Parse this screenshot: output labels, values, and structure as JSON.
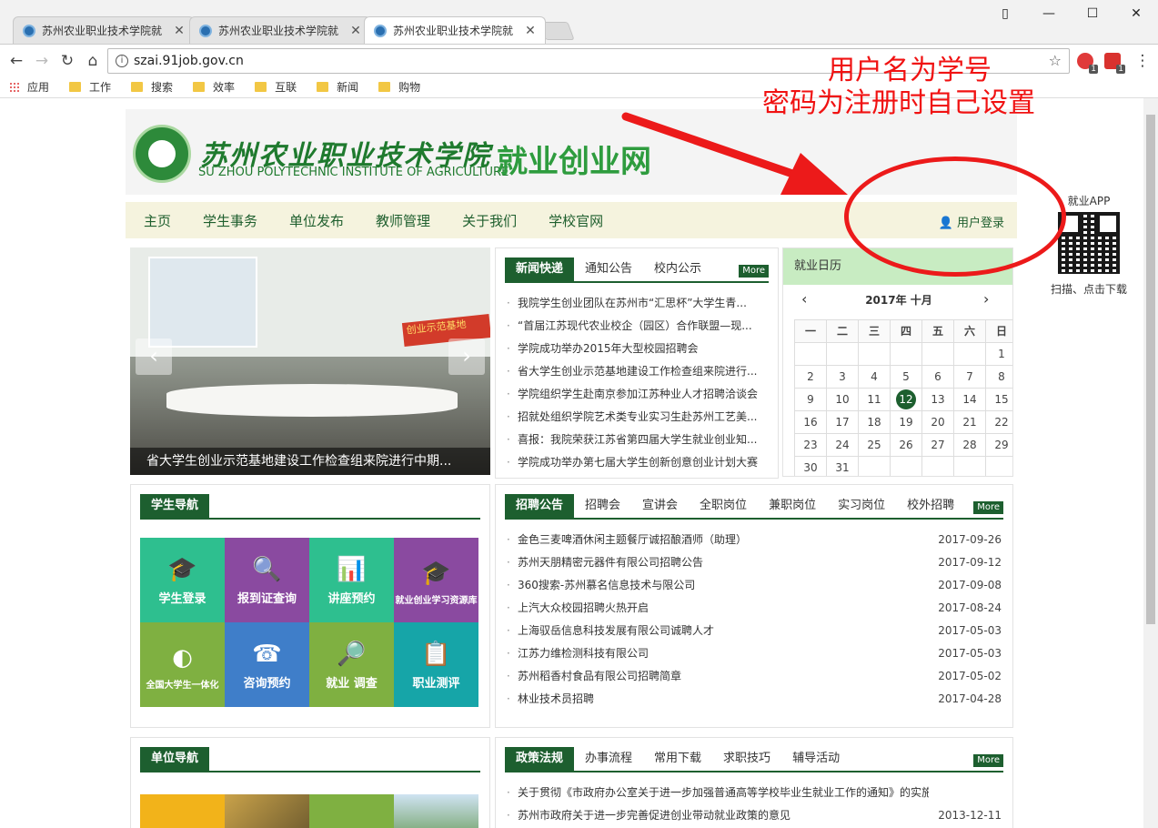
{
  "browser": {
    "tabs": [
      {
        "title": "苏州农业职业技术学院就"
      },
      {
        "title": "苏州农业职业技术学院就"
      },
      {
        "title": "苏州农业职业技术学院就"
      }
    ],
    "url": "szai.91job.gov.cn",
    "bookmarks": [
      "应用",
      "工作",
      "搜索",
      "效率",
      "互联",
      "新闻",
      "购物"
    ],
    "ext_badges": [
      "1",
      "1"
    ]
  },
  "annotation": {
    "line1": "用户名为学号",
    "line2": "密码为注册时自己设置"
  },
  "header": {
    "school_cn": "苏州农业职业技术学院",
    "school_en": "SU ZHOU POLYTECHNIC INSTITUTE OF AGRICULTURE",
    "site_name": "就业创业网"
  },
  "nav": {
    "items": [
      "主页",
      "学生事务",
      "单位发布",
      "教师管理",
      "关于我们",
      "学校官网"
    ],
    "login": "用户登录"
  },
  "slider": {
    "caption": "省大学生创业示范基地建设工作检查组来院进行中期...",
    "banner": "创业示范基地"
  },
  "news": {
    "tabs": [
      "新闻快递",
      "通知公告",
      "校内公示"
    ],
    "more": "More",
    "items": [
      "我院学生创业团队在苏州市“汇思杯”大学生青...",
      "“首届江苏现代农业校企（园区）合作联盟—现...",
      "学院成功举办2015年大型校园招聘会",
      "省大学生创业示范基地建设工作检查组来院进行...",
      "学院组织学生赴南京参加江苏种业人才招聘洽谈会",
      "招就处组织学院艺术类专业实习生赴苏州工艺美...",
      "喜报：我院荣获江苏省第四届大学生就业创业知...",
      "学院成功举办第七届大学生创新创意创业计划大赛"
    ]
  },
  "calendar": {
    "title": "就业日历",
    "month": "2017年 十月",
    "weekdays": [
      "一",
      "二",
      "三",
      "四",
      "五",
      "六",
      "日"
    ],
    "cells": [
      "",
      "",
      "",
      "",
      "",
      "",
      "1",
      "2",
      "3",
      "4",
      "5",
      "6",
      "7",
      "8",
      "9",
      "10",
      "11",
      "12",
      "13",
      "14",
      "15",
      "16",
      "17",
      "18",
      "19",
      "20",
      "21",
      "22",
      "23",
      "24",
      "25",
      "26",
      "27",
      "28",
      "29",
      "30",
      "31",
      "",
      "",
      "",
      "",
      ""
    ],
    "today": "12"
  },
  "app": {
    "label": "就业APP",
    "hint": "扫描、点击下载"
  },
  "student_guide": {
    "title": "学生导航",
    "tiles": [
      {
        "label": "学生登录",
        "color": "#2ebf8f"
      },
      {
        "label": "报到证查询",
        "color": "#8a4aa0"
      },
      {
        "label": "讲座预约",
        "color": "#2ebf8f"
      },
      {
        "label": "就业创业学习资源库",
        "color": "#8a4aa0"
      },
      {
        "label": "全国大学生一体化",
        "color": "#7fb041"
      },
      {
        "label": "咨询预约",
        "color": "#3f7ec9"
      },
      {
        "label": "就业 调查",
        "color": "#7fb041"
      },
      {
        "label": "职业测评",
        "color": "#16a5a8"
      }
    ]
  },
  "jobs": {
    "tabs": [
      "招聘公告",
      "招聘会",
      "宣讲会",
      "全职岗位",
      "兼职岗位",
      "实习岗位",
      "校外招聘"
    ],
    "more": "More",
    "items": [
      {
        "title": "金色三麦啤酒休闲主题餐厅诚招酿酒师（助理）",
        "date": "2017-09-26"
      },
      {
        "title": "苏州天朋精密元器件有限公司招聘公告",
        "date": "2017-09-12"
      },
      {
        "title": "360搜索-苏州慕名信息技术与限公司",
        "date": "2017-09-08"
      },
      {
        "title": "上汽大众校园招聘火热开启",
        "date": "2017-08-24"
      },
      {
        "title": "上海驭岳信息科技发展有限公司诚聘人才",
        "date": "2017-05-03"
      },
      {
        "title": "江苏力维检测科技有限公司",
        "date": "2017-05-03"
      },
      {
        "title": "苏州稻香村食品有限公司招聘简章",
        "date": "2017-05-02"
      },
      {
        "title": "林业技术员招聘",
        "date": "2017-04-28"
      }
    ]
  },
  "unit_guide": {
    "title": "单位导航"
  },
  "policy": {
    "tabs": [
      "政策法规",
      "办事流程",
      "常用下载",
      "求职技巧",
      "辅导活动"
    ],
    "more": "More",
    "items": [
      {
        "title": "关于贯彻《市政府办公室关于进一步加强普通高等学校毕业生就业工作的通知》的实施办法",
        "date": ""
      },
      {
        "title": "苏州市政府关于进一步完善促进创业带动就业政策的意见",
        "date": "2013-12-11"
      }
    ]
  },
  "colors": {
    "accent_green": "#1d5f2f",
    "annotation_red": "#f01212"
  }
}
